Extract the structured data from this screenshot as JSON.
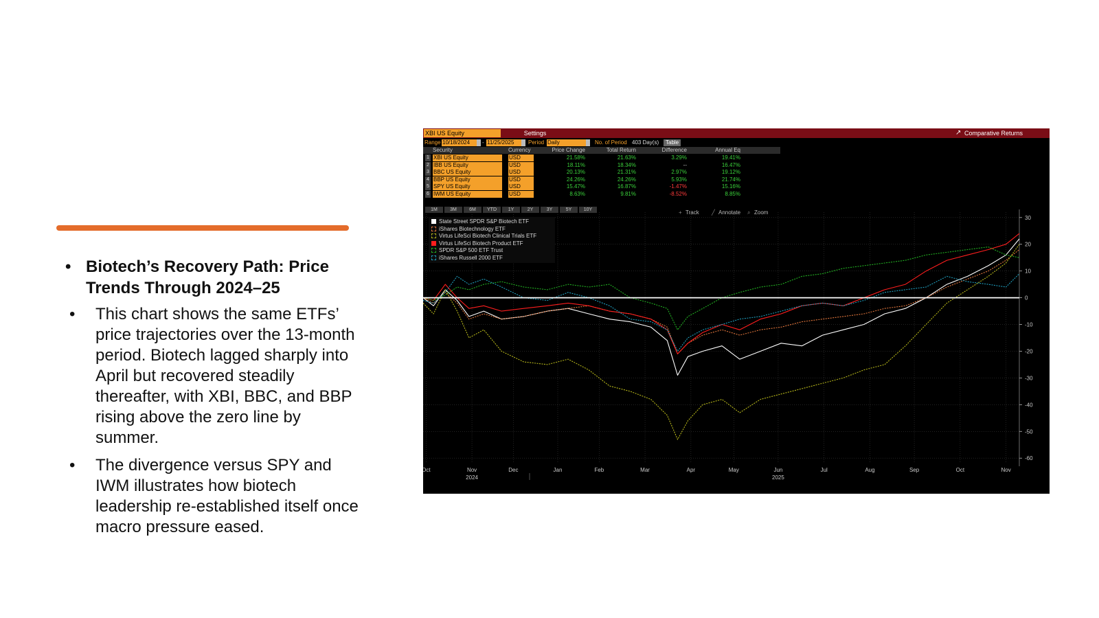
{
  "slide": {
    "heading": "Biotech’s Recovery Path: Price Trends Through 2024–25",
    "bullets": [
      "This chart shows the same ETFs’ price trajectories over the 13-month period. Biotech lagged sharply into April but recovered steadily thereafter, with XBI, BBC, and BBP rising above the zero line by summer.",
      "The divergence versus SPY and IWM illustrates how biotech leadership re-established itself once macro pressure eased."
    ],
    "bullet_glyph": "•"
  },
  "terminal": {
    "ticker": "XBI US Equity",
    "settings": "Settings",
    "mode": "Comparative Returns",
    "range_label": "Range",
    "range_from": "10/18/2024",
    "range_to": "11/25/2025",
    "period_label": "Period",
    "period": "Daily",
    "no_of_period_label": "No. of Period",
    "no_of_period": "403 Day(s)",
    "table_btn": "Table",
    "colors": {
      "header_bar": "#7a0d16",
      "field": "#f4a02a",
      "positive": "#3bd13b",
      "negative": "#ff3b3b"
    },
    "columns": [
      "Security",
      "Currency",
      "Price Change",
      "Total Return",
      "Difference",
      "Annual Eq"
    ],
    "rows": [
      {
        "n": "1",
        "security": "XBI US Equity",
        "currency": "USD",
        "price_change": "21.58%",
        "total_return": "21.63%",
        "difference": "3.29%",
        "annual_eq": "19.41%"
      },
      {
        "n": "2",
        "security": "IBB US Equity",
        "currency": "USD",
        "price_change": "18.11%",
        "total_return": "18.34%",
        "difference": "--",
        "annual_eq": "16.47%"
      },
      {
        "n": "3",
        "security": "BBC US Equity",
        "currency": "USD",
        "price_change": "20.13%",
        "total_return": "21.31%",
        "difference": "2.97%",
        "annual_eq": "19.12%"
      },
      {
        "n": "4",
        "security": "BBP US Equity",
        "currency": "USD",
        "price_change": "24.26%",
        "total_return": "24.26%",
        "difference": "5.93%",
        "annual_eq": "21.74%"
      },
      {
        "n": "5",
        "security": "SPY US Equity",
        "currency": "USD",
        "price_change": "15.47%",
        "total_return": "16.87%",
        "difference": "-1.47%",
        "annual_eq": "15.16%"
      },
      {
        "n": "6",
        "security": "IWM US Equity",
        "currency": "USD",
        "price_change": "8.63%",
        "total_return": "9.81%",
        "difference": "-8.52%",
        "annual_eq": "8.85%"
      }
    ],
    "periods": [
      "1M",
      "3M",
      "6M",
      "YTD",
      "1Y",
      "2Y",
      "3Y",
      "5Y",
      "10Y"
    ],
    "tools": [
      "Track",
      "Annotate",
      "Zoom"
    ]
  },
  "chart_data": {
    "type": "line",
    "ylim": [
      -62,
      32
    ],
    "yticks": [
      30,
      20,
      10,
      0,
      -10,
      -20,
      -30,
      -40,
      -50,
      -60
    ],
    "zero_line": 0,
    "grid": true,
    "legend_position": "top-left",
    "x_range": [
      "2024-10-18",
      "2025-11-25"
    ],
    "x_ticks": [
      {
        "label": "Oct",
        "date": "2024-10-20"
      },
      {
        "label": "Nov",
        "date": "2024-11-20"
      },
      {
        "label": "Dec",
        "date": "2024-12-18"
      },
      {
        "label": "Jan",
        "date": "2025-01-17"
      },
      {
        "label": "Feb",
        "date": "2025-02-14"
      },
      {
        "label": "Mar",
        "date": "2025-03-17"
      },
      {
        "label": "Apr",
        "date": "2025-04-17"
      },
      {
        "label": "May",
        "date": "2025-05-16"
      },
      {
        "label": "Jun",
        "date": "2025-06-15"
      },
      {
        "label": "Jul",
        "date": "2025-07-16"
      },
      {
        "label": "Aug",
        "date": "2025-08-16"
      },
      {
        "label": "Sep",
        "date": "2025-09-15"
      },
      {
        "label": "Oct",
        "date": "2025-10-16"
      },
      {
        "label": "Nov",
        "date": "2025-11-16"
      }
    ],
    "year_labels": [
      {
        "label": "2024",
        "date": "2024-11-20"
      },
      {
        "label": "2025",
        "date": "2025-06-15"
      }
    ],
    "series": [
      {
        "name": "State Street SPDR S&P Biotech ETF",
        "color": "#ffffff",
        "dashed": false,
        "points": [
          [
            "2024-10-18",
            0
          ],
          [
            "2024-10-25",
            -3
          ],
          [
            "2024-11-02",
            3
          ],
          [
            "2024-11-10",
            -1
          ],
          [
            "2024-11-18",
            -7
          ],
          [
            "2024-11-28",
            -5
          ],
          [
            "2024-12-10",
            -8
          ],
          [
            "2024-12-25",
            -7
          ],
          [
            "2025-01-10",
            -5
          ],
          [
            "2025-01-24",
            -4
          ],
          [
            "2025-02-07",
            -6
          ],
          [
            "2025-02-21",
            -8
          ],
          [
            "2025-03-07",
            -9
          ],
          [
            "2025-03-21",
            -11
          ],
          [
            "2025-04-01",
            -16
          ],
          [
            "2025-04-08",
            -29
          ],
          [
            "2025-04-15",
            -22
          ],
          [
            "2025-04-25",
            -20
          ],
          [
            "2025-05-08",
            -18
          ],
          [
            "2025-05-20",
            -23
          ],
          [
            "2025-06-03",
            -20
          ],
          [
            "2025-06-17",
            -17
          ],
          [
            "2025-07-01",
            -18
          ],
          [
            "2025-07-15",
            -14
          ],
          [
            "2025-07-29",
            -12
          ],
          [
            "2025-08-12",
            -10
          ],
          [
            "2025-08-26",
            -6
          ],
          [
            "2025-09-09",
            -4
          ],
          [
            "2025-09-23",
            0
          ],
          [
            "2025-10-07",
            5
          ],
          [
            "2025-10-21",
            8
          ],
          [
            "2025-11-04",
            12
          ],
          [
            "2025-11-16",
            16
          ],
          [
            "2025-11-25",
            22
          ]
        ]
      },
      {
        "name": "iShares Biotechnology ETF",
        "color": "#e2763c",
        "dashed": true,
        "points": [
          [
            "2024-10-18",
            0
          ],
          [
            "2024-10-25",
            -2
          ],
          [
            "2024-11-02",
            2
          ],
          [
            "2024-11-10",
            -2
          ],
          [
            "2024-11-18",
            -8
          ],
          [
            "2024-11-28",
            -6
          ],
          [
            "2024-12-10",
            -8
          ],
          [
            "2024-12-25",
            -7
          ],
          [
            "2025-01-10",
            -5
          ],
          [
            "2025-01-24",
            -4
          ],
          [
            "2025-02-07",
            -3
          ],
          [
            "2025-02-21",
            -5
          ],
          [
            "2025-03-07",
            -6
          ],
          [
            "2025-03-21",
            -8
          ],
          [
            "2025-04-01",
            -11
          ],
          [
            "2025-04-08",
            -21
          ],
          [
            "2025-04-15",
            -17
          ],
          [
            "2025-04-25",
            -14
          ],
          [
            "2025-05-08",
            -12
          ],
          [
            "2025-05-20",
            -14
          ],
          [
            "2025-06-03",
            -12
          ],
          [
            "2025-06-17",
            -11
          ],
          [
            "2025-07-01",
            -9
          ],
          [
            "2025-07-15",
            -8
          ],
          [
            "2025-07-29",
            -7
          ],
          [
            "2025-08-12",
            -6
          ],
          [
            "2025-08-26",
            -4
          ],
          [
            "2025-09-09",
            -3
          ],
          [
            "2025-09-23",
            0
          ],
          [
            "2025-10-07",
            4
          ],
          [
            "2025-10-21",
            7
          ],
          [
            "2025-11-04",
            10
          ],
          [
            "2025-11-16",
            14
          ],
          [
            "2025-11-25",
            18
          ]
        ]
      },
      {
        "name": "Virtus LifeSci Biotech Clinical Trials ETF",
        "color": "#b8b81a",
        "dashed": true,
        "points": [
          [
            "2024-10-18",
            -2
          ],
          [
            "2024-10-25",
            -6
          ],
          [
            "2024-11-02",
            3
          ],
          [
            "2024-11-10",
            -5
          ],
          [
            "2024-11-18",
            -15
          ],
          [
            "2024-11-28",
            -12
          ],
          [
            "2024-12-10",
            -20
          ],
          [
            "2024-12-25",
            -24
          ],
          [
            "2025-01-10",
            -25
          ],
          [
            "2025-01-24",
            -23
          ],
          [
            "2025-02-07",
            -27
          ],
          [
            "2025-02-21",
            -33
          ],
          [
            "2025-03-07",
            -35
          ],
          [
            "2025-03-21",
            -38
          ],
          [
            "2025-04-01",
            -44
          ],
          [
            "2025-04-08",
            -53
          ],
          [
            "2025-04-15",
            -46
          ],
          [
            "2025-04-25",
            -40
          ],
          [
            "2025-05-08",
            -38
          ],
          [
            "2025-05-20",
            -43
          ],
          [
            "2025-06-03",
            -38
          ],
          [
            "2025-06-17",
            -36
          ],
          [
            "2025-07-01",
            -34
          ],
          [
            "2025-07-15",
            -32
          ],
          [
            "2025-07-29",
            -30
          ],
          [
            "2025-08-12",
            -27
          ],
          [
            "2025-08-26",
            -25
          ],
          [
            "2025-09-09",
            -18
          ],
          [
            "2025-09-23",
            -10
          ],
          [
            "2025-10-07",
            -2
          ],
          [
            "2025-10-21",
            3
          ],
          [
            "2025-11-04",
            8
          ],
          [
            "2025-11-16",
            13
          ],
          [
            "2025-11-25",
            20
          ]
        ]
      },
      {
        "name": "Virtus LifeSci Biotech Product ETF",
        "color": "#ff1e1e",
        "dashed": false,
        "points": [
          [
            "2024-10-18",
            0
          ],
          [
            "2024-10-25",
            -1
          ],
          [
            "2024-11-02",
            5
          ],
          [
            "2024-11-10",
            0
          ],
          [
            "2024-11-18",
            -4
          ],
          [
            "2024-11-28",
            -3
          ],
          [
            "2024-12-10",
            -5
          ],
          [
            "2024-12-25",
            -4
          ],
          [
            "2025-01-10",
            -3
          ],
          [
            "2025-01-24",
            -2
          ],
          [
            "2025-02-07",
            -3
          ],
          [
            "2025-02-21",
            -5
          ],
          [
            "2025-03-07",
            -6
          ],
          [
            "2025-03-21",
            -8
          ],
          [
            "2025-04-01",
            -12
          ],
          [
            "2025-04-08",
            -21
          ],
          [
            "2025-04-15",
            -17
          ],
          [
            "2025-04-25",
            -13
          ],
          [
            "2025-05-08",
            -10
          ],
          [
            "2025-05-20",
            -12
          ],
          [
            "2025-06-03",
            -8
          ],
          [
            "2025-06-17",
            -6
          ],
          [
            "2025-07-01",
            -3
          ],
          [
            "2025-07-15",
            -2
          ],
          [
            "2025-07-29",
            -3
          ],
          [
            "2025-08-12",
            0
          ],
          [
            "2025-08-26",
            3
          ],
          [
            "2025-09-09",
            5
          ],
          [
            "2025-09-23",
            10
          ],
          [
            "2025-10-07",
            14
          ],
          [
            "2025-10-21",
            16
          ],
          [
            "2025-11-04",
            18
          ],
          [
            "2025-11-16",
            20
          ],
          [
            "2025-11-25",
            24
          ]
        ]
      },
      {
        "name": "SPDR S&P 500 ETF Trust",
        "color": "#22b122",
        "dashed": true,
        "points": [
          [
            "2024-10-18",
            0
          ],
          [
            "2024-10-25",
            -1
          ],
          [
            "2024-11-02",
            1
          ],
          [
            "2024-11-10",
            4
          ],
          [
            "2024-11-18",
            3
          ],
          [
            "2024-11-28",
            5
          ],
          [
            "2024-12-10",
            6
          ],
          [
            "2024-12-25",
            4
          ],
          [
            "2025-01-10",
            3
          ],
          [
            "2025-01-24",
            5
          ],
          [
            "2025-02-07",
            4
          ],
          [
            "2025-02-21",
            5
          ],
          [
            "2025-03-07",
            0
          ],
          [
            "2025-03-21",
            -2
          ],
          [
            "2025-04-01",
            -4
          ],
          [
            "2025-04-08",
            -12
          ],
          [
            "2025-04-15",
            -7
          ],
          [
            "2025-04-25",
            -4
          ],
          [
            "2025-05-08",
            0
          ],
          [
            "2025-05-20",
            2
          ],
          [
            "2025-06-03",
            4
          ],
          [
            "2025-06-17",
            5
          ],
          [
            "2025-07-01",
            8
          ],
          [
            "2025-07-15",
            9
          ],
          [
            "2025-07-29",
            11
          ],
          [
            "2025-08-12",
            12
          ],
          [
            "2025-08-26",
            13
          ],
          [
            "2025-09-09",
            14
          ],
          [
            "2025-09-23",
            16
          ],
          [
            "2025-10-07",
            17
          ],
          [
            "2025-10-21",
            18
          ],
          [
            "2025-11-04",
            19
          ],
          [
            "2025-11-16",
            16
          ],
          [
            "2025-11-25",
            15
          ]
        ]
      },
      {
        "name": "iShares Russell 2000 ETF",
        "color": "#1f9fbf",
        "dashed": true,
        "points": [
          [
            "2024-10-18",
            -1
          ],
          [
            "2024-10-25",
            -2
          ],
          [
            "2024-11-02",
            2
          ],
          [
            "2024-11-10",
            8
          ],
          [
            "2024-11-18",
            5
          ],
          [
            "2024-11-28",
            7
          ],
          [
            "2024-12-10",
            4
          ],
          [
            "2024-12-25",
            0
          ],
          [
            "2025-01-10",
            -1
          ],
          [
            "2025-01-24",
            2
          ],
          [
            "2025-02-07",
            0
          ],
          [
            "2025-02-21",
            -3
          ],
          [
            "2025-03-07",
            -8
          ],
          [
            "2025-03-21",
            -9
          ],
          [
            "2025-04-01",
            -12
          ],
          [
            "2025-04-08",
            -20
          ],
          [
            "2025-04-15",
            -15
          ],
          [
            "2025-04-25",
            -12
          ],
          [
            "2025-05-08",
            -10
          ],
          [
            "2025-05-20",
            -8
          ],
          [
            "2025-06-03",
            -7
          ],
          [
            "2025-06-17",
            -5
          ],
          [
            "2025-07-01",
            -3
          ],
          [
            "2025-07-15",
            -2
          ],
          [
            "2025-07-29",
            -3
          ],
          [
            "2025-08-12",
            -1
          ],
          [
            "2025-08-26",
            2
          ],
          [
            "2025-09-09",
            3
          ],
          [
            "2025-09-23",
            4
          ],
          [
            "2025-10-07",
            8
          ],
          [
            "2025-10-21",
            6
          ],
          [
            "2025-11-04",
            5
          ],
          [
            "2025-11-16",
            4
          ],
          [
            "2025-11-25",
            9
          ]
        ]
      }
    ]
  }
}
